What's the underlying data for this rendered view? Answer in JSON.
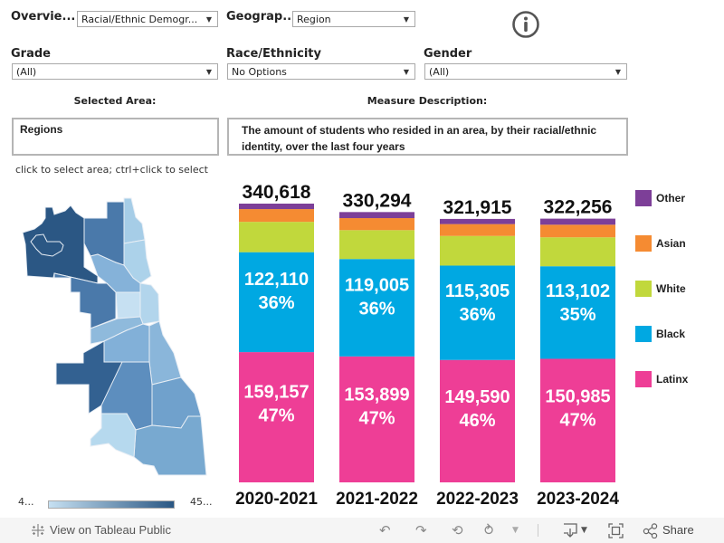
{
  "filters": {
    "overview": {
      "label": "Overvie...",
      "value": "Racial/Ethnic Demogr..."
    },
    "geography": {
      "label": "Geograp...",
      "value": "Region"
    },
    "grade": {
      "label": "Grade",
      "value": "(All)"
    },
    "race": {
      "label": "Race/Ethnicity",
      "value": "No Options"
    },
    "gender": {
      "label": "Gender",
      "value": "(All)"
    }
  },
  "info_icon": "info-icon",
  "selected_area": {
    "title": "Selected Area:",
    "value": "Regions"
  },
  "measure": {
    "title": "Measure Description:",
    "value": "The amount of students who resided in an area, by their racial/ethnic identity, over the last four years"
  },
  "map": {
    "hint": "click to select area; ctrl+click to select",
    "scale_min": "4...",
    "scale_max": "45...",
    "colors": [
      "#c6e0f2",
      "#2a5783"
    ]
  },
  "chart_data": {
    "type": "bar",
    "stacked": true,
    "title": "",
    "xlabel": "",
    "ylabel": "",
    "categories": [
      "2020-2021",
      "2021-2022",
      "2022-2023",
      "2023-2024"
    ],
    "totals": [
      "340,618",
      "330,294",
      "321,915",
      "322,256"
    ],
    "total_values": [
      340618,
      330294,
      321915,
      322256
    ],
    "series": [
      {
        "name": "Latinx",
        "color": "#ee3e96",
        "values": [
          159157,
          153899,
          149590,
          150985
        ],
        "labels": [
          "159,157",
          "153,899",
          "149,590",
          "150,985"
        ],
        "pct": [
          "47%",
          "47%",
          "46%",
          "47%"
        ]
      },
      {
        "name": "Black",
        "color": "#00a8e2",
        "values": [
          122110,
          119005,
          115305,
          113102
        ],
        "labels": [
          "122,110",
          "119,005",
          "115,305",
          "113,102"
        ],
        "pct": [
          "36%",
          "36%",
          "36%",
          "35%"
        ]
      },
      {
        "name": "White",
        "color": "#c1d83c",
        "values": [
          37051,
          35290,
          36220,
          35369
        ]
      },
      {
        "name": "Asian",
        "color": "#f58b32",
        "values": [
          15600,
          14700,
          14500,
          15400
        ]
      },
      {
        "name": "Other",
        "color": "#7d3f98",
        "values": [
          6700,
          7400,
          6300,
          7400
        ]
      }
    ],
    "legend": {
      "placement": "right",
      "order": [
        "Other",
        "Asian",
        "White",
        "Black",
        "Latinx"
      ]
    }
  },
  "footer": {
    "view_label": "View on Tableau Public",
    "share_label": "Share"
  }
}
